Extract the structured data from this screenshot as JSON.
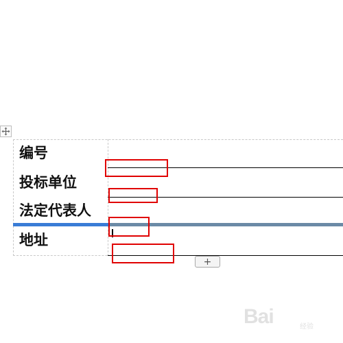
{
  "table": {
    "rows": [
      {
        "label": "编号"
      },
      {
        "label": "投标单位"
      },
      {
        "label": "法定代表人"
      },
      {
        "label": "地址"
      }
    ]
  },
  "controls": {
    "move_handle_icon": "four-way-arrow",
    "add_row_label": "+"
  },
  "colors": {
    "highlight": "#e00000",
    "selection": "#3a7cd6"
  },
  "watermark": {
    "logo": "Bai",
    "sub": "经验"
  }
}
